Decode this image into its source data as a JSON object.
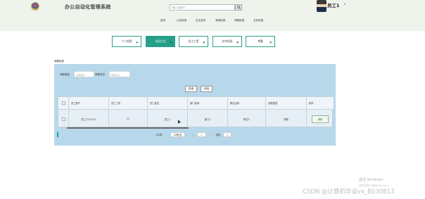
{
  "app": {
    "title": "办公自动化管理系统"
  },
  "search": {
    "placeholder": "输入关键词",
    "button_icon": "search-icon"
  },
  "user": {
    "name": "员工1",
    "caret": "▾"
  },
  "nav": [
    "首页",
    "公告信息",
    "企业资讯",
    "考勤信息",
    "请假信息",
    "文件信息"
  ],
  "quick_links": [
    {
      "label": "个人信息",
      "active": false
    },
    {
      "label": "请假信息",
      "active": true
    },
    {
      "label": "员工工资",
      "active": false
    },
    {
      "label": "文件信息",
      "active": false
    },
    {
      "label": "考勤",
      "active": false
    }
  ],
  "section": {
    "title": "请假信息"
  },
  "filters": [
    {
      "label": "请假类型",
      "placeholder": "请假类型"
    },
    {
      "label": "审核状态",
      "placeholder": "审核状态"
    }
  ],
  "buttons": {
    "query": "查询",
    "add": "添加"
  },
  "table": {
    "headers": [
      "员工账户",
      "员工工号",
      "员工姓名",
      "部门名称",
      "职位名称",
      "请假类型",
      "操作"
    ],
    "rows": [
      {
        "account": "员工1111111",
        "number": "11",
        "name": "员工1",
        "dept": "部门1",
        "position": "职位1",
        "type": "事假",
        "action": "详情"
      }
    ]
  },
  "pagination": {
    "total": "共1条",
    "page_size": "10条/页",
    "prev": "<",
    "page": "1",
    "next": ">",
    "goto_label": "前往",
    "goto_value": "1"
  },
  "watermark": {
    "line1": "激活 Windows",
    "line2": "转到\"设置\"以激活 Windows。",
    "csdn": "CSDN @计算机毕设vx_BS30813"
  },
  "colors": {
    "accent": "#27a08a",
    "panel": "#b7d7ea",
    "header_bg": "#eef3ec"
  }
}
